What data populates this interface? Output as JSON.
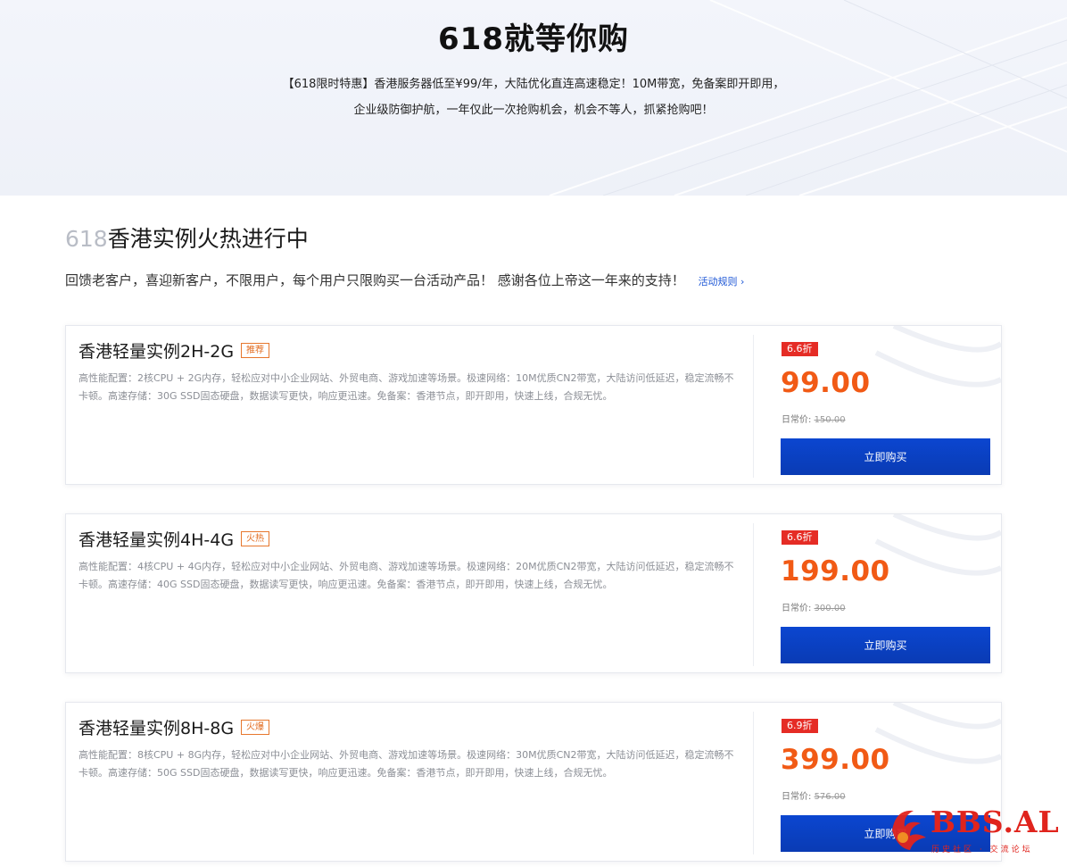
{
  "hero": {
    "title": "618就等你购",
    "subtitle_line1": "【618限时特惠】香港服务器低至¥99/年，大陆优化直连高速稳定！10M带宽，免备案即开即用，",
    "subtitle_line2": "企业级防御护航，一年仅此一次抢购机会，机会不等人，抓紧抢购吧！"
  },
  "section": {
    "title_num": "618",
    "title_text": "香港实例火热进行中",
    "description": "回馈老客户，喜迎新客户，不限用户，每个用户只限购买一台活动产品！ 感谢各位上帝这一年来的支持！",
    "rules_link": "活动规则 ›"
  },
  "products": [
    {
      "name": "香港轻量实例2H-2G",
      "tag": "推荐",
      "desc": "高性能配置：2核CPU + 2G内存，轻松应对中小企业网站、外贸电商、游戏加速等场景。极速网络：10M优质CN2带宽，大陆访问低延迟，稳定流畅不卡顿。高速存储：30G SSD固态硬盘，数据读写更快，响应更迅速。免备案：香港节点，即开即用，快速上线，合规无忧。",
      "discount": "6.6折",
      "price": "99.00",
      "orig_label": "日常价:",
      "orig_price": "150.00",
      "buy_label": "立即购买"
    },
    {
      "name": "香港轻量实例4H-4G",
      "tag": "火热",
      "desc": "高性能配置：4核CPU + 4G内存，轻松应对中小企业网站、外贸电商、游戏加速等场景。极速网络：20M优质CN2带宽，大陆访问低延迟，稳定流畅不卡顿。高速存储：40G SSD固态硬盘，数据读写更快，响应更迅速。免备案：香港节点，即开即用，快速上线，合规无忧。",
      "discount": "6.6折",
      "price": "199.00",
      "orig_label": "日常价:",
      "orig_price": "300.00",
      "buy_label": "立即购买"
    },
    {
      "name": "香港轻量实例8H-8G",
      "tag": "火爆",
      "desc": "高性能配置：8核CPU + 8G内存，轻松应对中小企业网站、外贸电商、游戏加速等场景。极速网络：30M优质CN2带宽，大陆访问低延迟，稳定流畅不卡顿。高速存储：50G SSD固态硬盘，数据读写更快，响应更迅速。免备案：香港节点，即开即用，快速上线，合规无忧。",
      "discount": "6.9折",
      "price": "399.00",
      "orig_label": "日常价:",
      "orig_price": "576.00",
      "buy_label": "立即购买"
    }
  ],
  "watermark": {
    "brand": "BBS.AL",
    "tagline": "历史社区 · 交流论坛"
  },
  "colors": {
    "accent_blue": "#0b46d0",
    "price_orange": "#f15a15",
    "discount_red": "#e52c25",
    "tag_orange": "#e7772d",
    "watermark_red": "#e0241d"
  }
}
